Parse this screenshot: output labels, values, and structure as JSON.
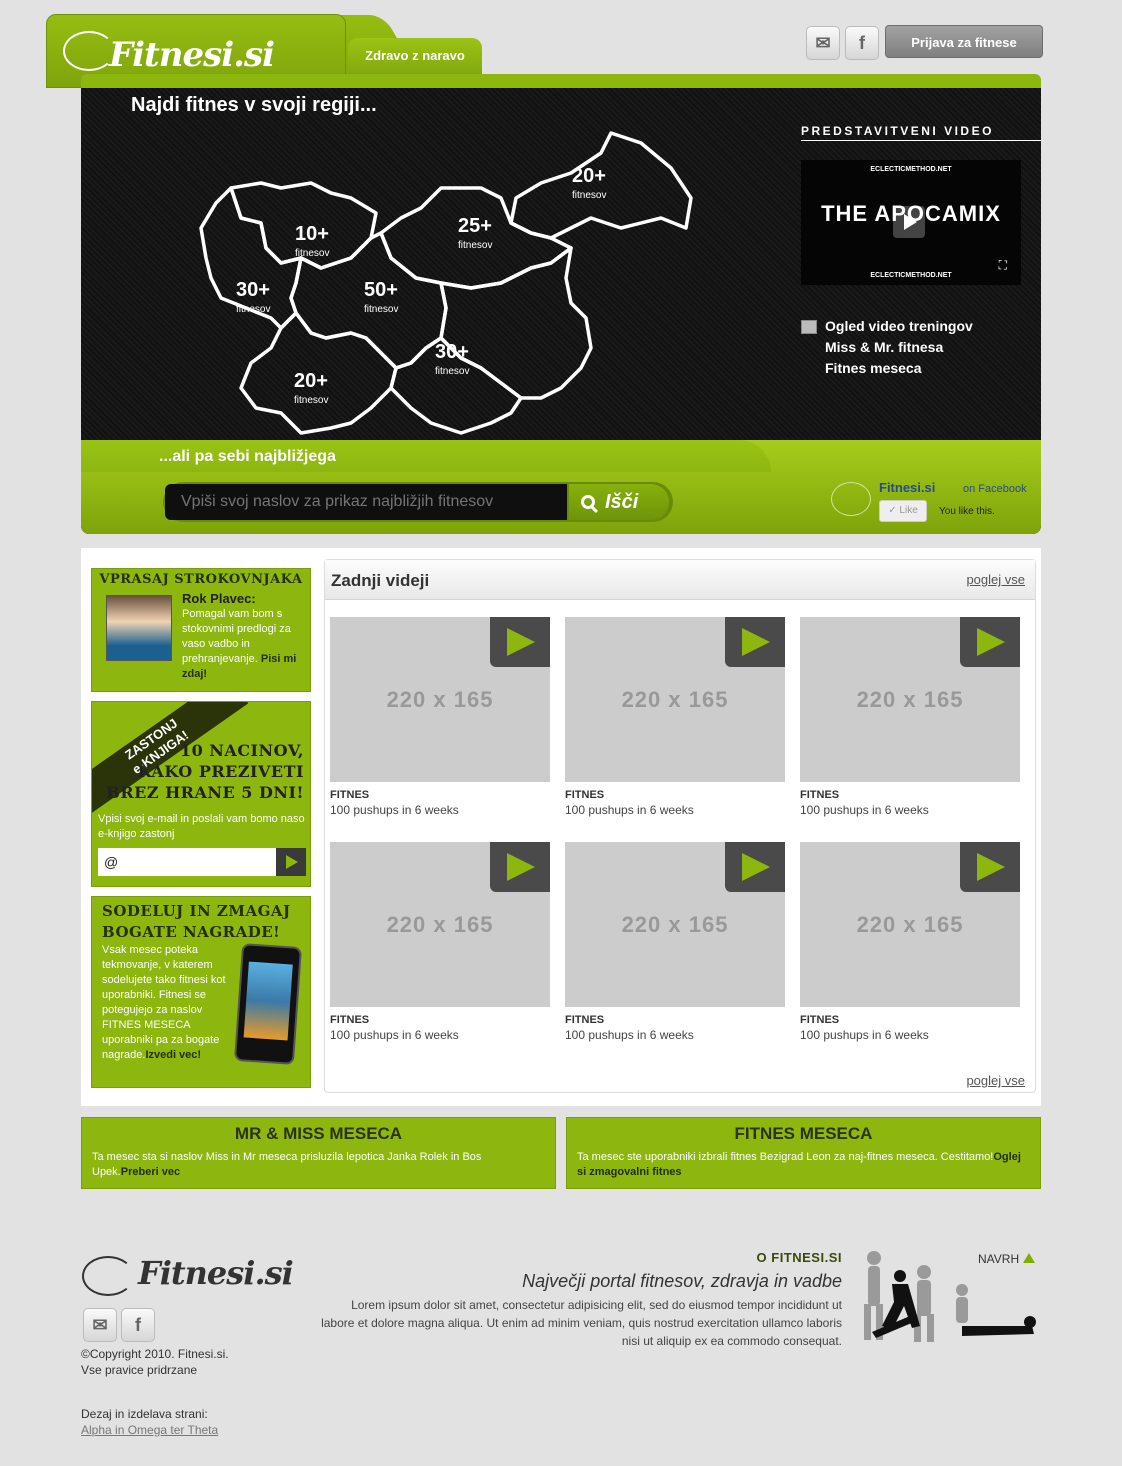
{
  "header": {
    "logo_text": "Fitnesi.si",
    "tab_label": "Zdravo z naravo",
    "mail_icon": "mail-icon",
    "facebook_icon": "facebook-icon",
    "login_button": "Prijava za fitnese"
  },
  "hero": {
    "title": "Najdi fitnes v svoji regiji...",
    "regions": [
      {
        "count": "10+",
        "label": "fitnesov"
      },
      {
        "count": "30+",
        "label": "fitnesov"
      },
      {
        "count": "50+",
        "label": "fitnesov"
      },
      {
        "count": "25+",
        "label": "fitnesov"
      },
      {
        "count": "20+",
        "label": "fitnesov"
      },
      {
        "count": "30+",
        "label": "fitnesov"
      },
      {
        "count": "20+",
        "label": "fitnesov"
      }
    ],
    "video_heading": "PREDSTAVITVENI VIDEO",
    "video_top": "ECLECTICMETHOD.NET",
    "video_title": "THE APOCAMIX",
    "video_bottom": "ECLECTICMETHOD.NET",
    "video_links": [
      "Ogled video treningov",
      "Miss & Mr. fitnesa",
      "Fitnes meseca"
    ],
    "near_title": "...ali pa sebi najbližjega",
    "search_placeholder": "Vpiši svoj naslov za prikaz najbližjih fitnesov",
    "search_button": "Išči",
    "facebook": {
      "name": "Fitnesi.si",
      "on": "on Facebook",
      "like": "Like",
      "you_like": "You like this."
    }
  },
  "sidebar": {
    "expert": {
      "title": "VPRASAJ STROKOVNJAKA",
      "name": "Rok Plavec:",
      "text": "Pomagal vam bom s stokovnimi predlogi za vaso vadbo in prehranjevanje.",
      "link": "Pisi mi zdaj!"
    },
    "ebook": {
      "ribbon_line1": "ZASTONJ",
      "ribbon_line2": "e-KNJIGA!",
      "title_line1": "10 NACINOV,",
      "title_line2": "KAKO PREZIVETI",
      "title_line3": "BREZ HRANE 5 DNI!",
      "text": "Vpisi svoj e-mail in poslali vam bomo naso e-knjigo zastonj",
      "email_value": "@"
    },
    "prize": {
      "title_line1": "SODELUJ IN ZMAGAJ",
      "title_line2": "BOGATE NAGRADE!",
      "text": "Vsak mesec poteka tekmovanje, v katerem sodelujete tako fitnesi kot uporabniki. Fitnesi se potegujejo za naslov FITNES MESECA uporabniki pa za bogate nagrade.",
      "link": "Izvedi vec!"
    }
  },
  "videos": {
    "title": "Zadnji videji",
    "see_all_top": "poglej vse",
    "see_all_bottom": "poglej vse",
    "items": [
      {
        "thumb": "220 x 165",
        "category": "FITNES",
        "name": "100 pushups in 6 weeks"
      },
      {
        "thumb": "220 x 165",
        "category": "FITNES",
        "name": "100 pushups in 6 weeks"
      },
      {
        "thumb": "220 x 165",
        "category": "FITNES",
        "name": "100 pushups in 6 weeks"
      },
      {
        "thumb": "220 x 165",
        "category": "FITNES",
        "name": "100 pushups in 6 weeks"
      },
      {
        "thumb": "220 x 165",
        "category": "FITNES",
        "name": "100 pushups in 6 weeks"
      },
      {
        "thumb": "220 x 165",
        "category": "FITNES",
        "name": "100 pushups in 6 weeks"
      }
    ]
  },
  "bars": {
    "mr_miss": {
      "title": "MR & MISS MESECA",
      "text": "Ta mesec sta si naslov Miss in Mr meseca prisluzila lepotica Janka Rolek in Bos Upek.",
      "link": "Preberi vec"
    },
    "fitnes": {
      "title": "FITNES MESECA",
      "text": "Ta mesec ste uporabniki izbrali fitnes Bezigrad Leon za naj-fitnes meseca. Cestitamo!",
      "link": "Oglej si zmagovalni fitnes"
    }
  },
  "footer": {
    "logo_text": "Fitnesi.si",
    "copyright_line1": "©Copyright 2010. Fitnesi.si.",
    "copyright_line2": "Vse pravice pridrzane",
    "design_label": "Dezaj in izdelava strani:",
    "design_link": "Alpha in Omega ter Theta",
    "about_heading": "O FITNESI.SI",
    "about_sub": "Največji portal fitnesov, zdravja in vadbe",
    "about_text": "Lorem ipsum dolor sit amet, consectetur adipisicing elit, sed do eiusmod tempor incididunt ut labore et dolore magna aliqua. Ut enim ad minim veniam, quis nostrud exercitation ullamco laboris nisi ut aliquip ex ea commodo consequat.",
    "back_to_top": "NAVRH"
  },
  "colors": {
    "brand_green": "#8db60f",
    "dark_green": "#243000",
    "hero_dark": "#111111"
  }
}
